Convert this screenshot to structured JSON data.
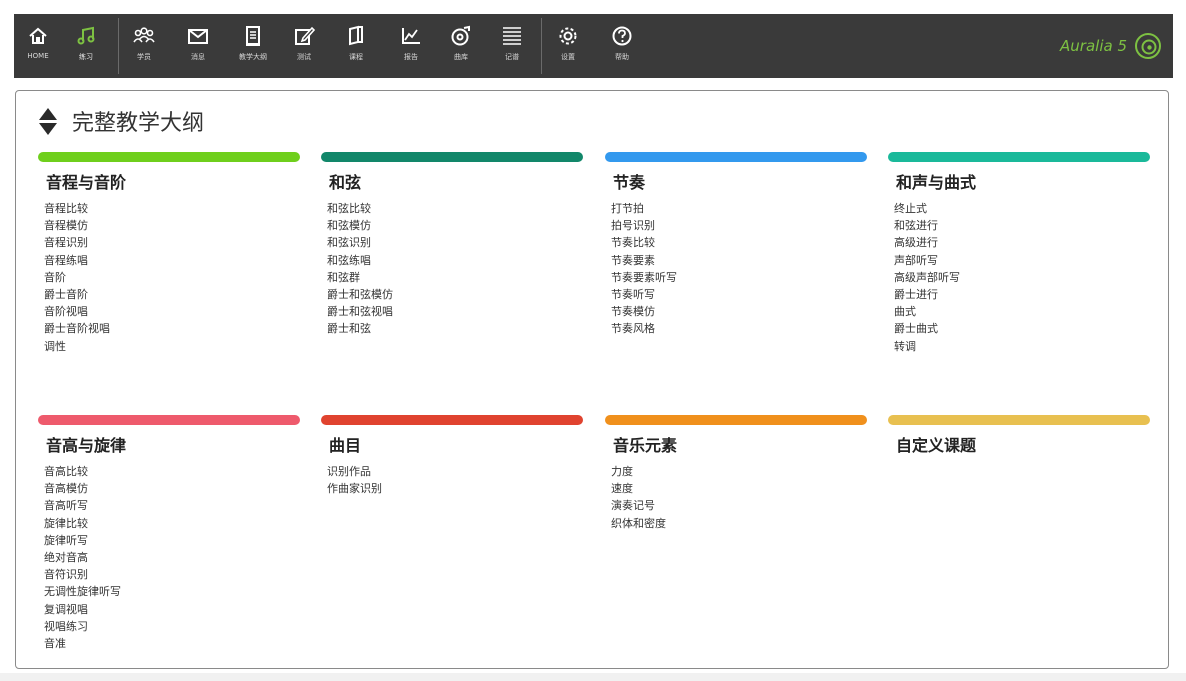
{
  "toolbar": {
    "items": [
      {
        "label": "HOME",
        "icon": "home-icon"
      },
      {
        "label": "练习",
        "icon": "music-note-icon"
      },
      {
        "label": "学员",
        "icon": "users-icon"
      },
      {
        "label": "消息",
        "icon": "mail-icon"
      },
      {
        "label": "教学大纲",
        "icon": "document-icon"
      },
      {
        "label": "测试",
        "icon": "edit-icon"
      },
      {
        "label": "课程",
        "icon": "book-icon"
      },
      {
        "label": "报告",
        "icon": "chart-icon"
      },
      {
        "label": "曲库",
        "icon": "music-disc-icon"
      },
      {
        "label": "记谱",
        "icon": "lines-icon"
      },
      {
        "label": "设置",
        "icon": "gear-icon"
      },
      {
        "label": "帮助",
        "icon": "help-icon"
      }
    ],
    "active_index": 1,
    "brand": "Auralia 5"
  },
  "panel": {
    "title": "完整教学大纲"
  },
  "categories": [
    {
      "title": "音程与音阶",
      "color": "#6fcf1c",
      "items": [
        "音程比较",
        "音程模仿",
        "音程识别",
        "音程练唱",
        "音阶",
        "爵士音阶",
        "音阶视唱",
        "爵士音阶视唱",
        "调性"
      ]
    },
    {
      "title": "和弦",
      "color": "#12876a",
      "items": [
        "和弦比较",
        "和弦模仿",
        "和弦识别",
        "和弦练唱",
        "和弦群",
        "爵士和弦模仿",
        "爵士和弦视唱",
        "爵士和弦"
      ]
    },
    {
      "title": "节奏",
      "color": "#3399ee",
      "items": [
        "打节拍",
        "拍号识别",
        "节奏比较",
        "节奏要素",
        "节奏要素听写",
        "节奏听写",
        "节奏模仿",
        "节奏风格"
      ]
    },
    {
      "title": "和声与曲式",
      "color": "#1ab99a",
      "items": [
        "终止式",
        "和弦进行",
        "高级进行",
        "声部听写",
        "高级声部听写",
        "爵士进行",
        "曲式",
        "爵士曲式",
        "转调"
      ]
    },
    {
      "title": "音高与旋律",
      "color": "#ee5a6c",
      "items": [
        "音高比较",
        "音高模仿",
        "音高听写",
        "旋律比较",
        "旋律听写",
        "绝对音高",
        "音符识别",
        "无调性旋律听写",
        "复调视唱",
        "视唱练习",
        "音准"
      ]
    },
    {
      "title": "曲目",
      "color": "#e0432f",
      "items": [
        "识别作品",
        "作曲家识别"
      ]
    },
    {
      "title": "音乐元素",
      "color": "#f0901c",
      "items": [
        "力度",
        "速度",
        "演奏记号",
        "织体和密度"
      ]
    },
    {
      "title": "自定义课题",
      "color": "#e8c050",
      "items": []
    }
  ]
}
